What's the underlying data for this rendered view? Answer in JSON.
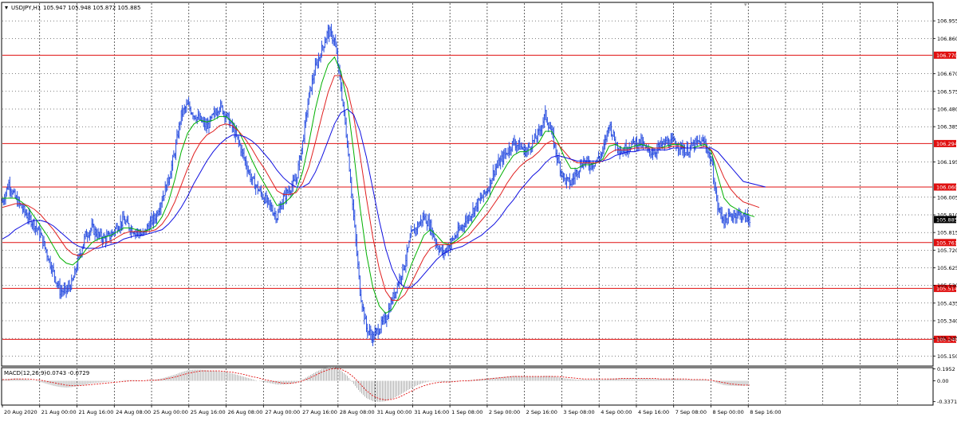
{
  "chart_data": {
    "type": "candlestick",
    "symbol_label": "USDJPY,H1",
    "ohlc_text": "105.947 105.948 105.872 105.885",
    "main_pane": {
      "ylim": [
        105.1,
        107.05
      ],
      "price_ticks": [
        "106.955",
        "106.860",
        "106.670",
        "106.575",
        "106.480",
        "106.385",
        "106.195",
        "106.005",
        "105.910",
        "105.815",
        "105.720",
        "105.625",
        "105.530",
        "105.435",
        "105.340",
        "105.245",
        "105.150"
      ],
      "horizontal_levels": [
        106.77,
        106.294,
        106.06,
        105.761,
        105.514,
        105.24
      ],
      "horizontal_level_labels": [
        "106.770",
        "106.294",
        "106.060",
        "105.761",
        "105.514",
        "105.240"
      ],
      "current_price": 105.885,
      "current_price_label": "105.885",
      "close_series": [
        105.98,
        106.08,
        106.0,
        105.95,
        105.9,
        105.86,
        105.8,
        105.7,
        105.6,
        105.5,
        105.5,
        105.55,
        105.68,
        105.8,
        105.84,
        105.8,
        105.78,
        105.8,
        105.85,
        105.88,
        105.84,
        105.82,
        105.8,
        105.86,
        105.9,
        106.0,
        106.1,
        106.25,
        106.45,
        106.5,
        106.45,
        106.42,
        106.38,
        106.44,
        106.5,
        106.45,
        106.38,
        106.3,
        106.2,
        106.1,
        106.05,
        106.0,
        105.95,
        105.9,
        106.0,
        106.05,
        106.1,
        106.3,
        106.55,
        106.7,
        106.8,
        106.9,
        106.85,
        106.6,
        106.3,
        105.9,
        105.5,
        105.3,
        105.25,
        105.3,
        105.35,
        105.45,
        105.55,
        105.65,
        105.8,
        105.85,
        105.9,
        105.85,
        105.75,
        105.7,
        105.75,
        105.8,
        105.85,
        105.9,
        105.95,
        106.0,
        106.05,
        106.15,
        106.2,
        106.25,
        106.3,
        106.28,
        106.25,
        106.3,
        106.35,
        106.45,
        106.35,
        106.2,
        106.1,
        106.08,
        106.15,
        106.2,
        106.18,
        106.2,
        106.25,
        106.4,
        106.3,
        106.25,
        106.28,
        106.3,
        106.3,
        106.25,
        106.25,
        106.28,
        106.3,
        106.3,
        106.28,
        106.25,
        106.28,
        106.3,
        106.3,
        106.2,
        105.95,
        105.88,
        105.9,
        105.92,
        105.9,
        105.885
      ],
      "overlay_lines": [
        {
          "color": "#00b000",
          "series": [
            106.0,
            106.0,
            106.0,
            105.98,
            105.95,
            105.9,
            105.85,
            105.8,
            105.74,
            105.68,
            105.65,
            105.64,
            105.67,
            105.72,
            105.76,
            105.78,
            105.79,
            105.8,
            105.82,
            105.84,
            105.84,
            105.83,
            105.82,
            105.83,
            105.85,
            105.9,
            105.98,
            106.1,
            106.25,
            106.35,
            106.4,
            106.42,
            106.41,
            106.42,
            106.44,
            106.44,
            106.41,
            106.36,
            106.29,
            106.21,
            106.14,
            106.08,
            106.02,
            105.96,
            105.97,
            106.0,
            106.04,
            106.14,
            106.3,
            106.48,
            106.62,
            106.72,
            106.76,
            106.68,
            106.52,
            106.25,
            105.95,
            105.7,
            105.52,
            105.42,
            105.38,
            105.4,
            105.46,
            105.54,
            105.64,
            105.72,
            105.8,
            105.83,
            105.8,
            105.76,
            105.75,
            105.77,
            105.8,
            105.84,
            105.89,
            105.94,
            105.99,
            106.06,
            106.12,
            106.18,
            106.23,
            106.25,
            106.25,
            106.27,
            106.3,
            106.36,
            106.36,
            106.3,
            106.22,
            106.16,
            106.16,
            106.18,
            106.18,
            106.19,
            106.21,
            106.28,
            106.29,
            106.27,
            106.27,
            106.28,
            106.29,
            106.28,
            106.27,
            106.27,
            106.28,
            106.29,
            106.29,
            106.27,
            106.27,
            106.28,
            106.29,
            106.25,
            106.12,
            106.0,
            105.96,
            105.94,
            105.92,
            105.9
          ]
        },
        {
          "color": "#e02020",
          "series": [
            105.95,
            105.96,
            105.97,
            105.97,
            105.96,
            105.94,
            105.91,
            105.87,
            105.83,
            105.78,
            105.73,
            105.7,
            105.69,
            105.7,
            105.72,
            105.74,
            105.76,
            105.77,
            105.79,
            105.81,
            105.82,
            105.82,
            105.82,
            105.82,
            105.83,
            105.86,
            105.91,
            105.98,
            106.07,
            106.16,
            106.24,
            106.3,
            106.34,
            106.36,
            106.39,
            106.4,
            106.39,
            106.36,
            106.32,
            106.27,
            106.21,
            106.16,
            106.1,
            106.04,
            106.02,
            106.02,
            106.03,
            106.08,
            106.17,
            106.3,
            106.44,
            106.57,
            106.66,
            106.66,
            106.59,
            106.44,
            106.23,
            106.0,
            105.79,
            105.62,
            105.5,
            105.45,
            105.45,
            105.48,
            105.54,
            105.61,
            105.68,
            105.73,
            105.75,
            105.75,
            105.75,
            105.76,
            105.78,
            105.8,
            105.84,
            105.88,
            105.92,
            105.97,
            106.02,
            106.08,
            106.13,
            106.17,
            106.2,
            106.22,
            106.25,
            106.29,
            106.31,
            106.29,
            106.25,
            106.21,
            106.19,
            106.19,
            106.19,
            106.19,
            106.2,
            106.24,
            106.26,
            106.26,
            106.26,
            106.27,
            106.27,
            106.27,
            106.27,
            106.27,
            106.27,
            106.28,
            106.28,
            106.27,
            106.27,
            106.27,
            106.28,
            106.26,
            106.19,
            106.11,
            106.05,
            106.01,
            105.98,
            105.95
          ]
        },
        {
          "color": "#1010e0",
          "series": [
            105.78,
            105.8,
            105.83,
            105.85,
            105.87,
            105.88,
            105.88,
            105.87,
            105.85,
            105.82,
            105.79,
            105.76,
            105.74,
            105.73,
            105.73,
            105.73,
            105.74,
            105.75,
            105.76,
            105.78,
            105.79,
            105.8,
            105.8,
            105.81,
            105.82,
            105.83,
            105.86,
            105.9,
            105.95,
            106.01,
            106.08,
            106.14,
            106.2,
            106.25,
            106.29,
            106.32,
            106.34,
            106.34,
            106.33,
            106.31,
            106.28,
            106.24,
            106.2,
            106.15,
            106.11,
            106.08,
            106.06,
            106.06,
            106.08,
            106.14,
            106.22,
            106.31,
            106.4,
            106.46,
            106.48,
            106.45,
            106.36,
            106.22,
            106.05,
            105.88,
            105.73,
            105.62,
            105.55,
            105.52,
            105.52,
            105.55,
            105.59,
            105.63,
            105.67,
            105.7,
            105.72,
            105.73,
            105.74,
            105.76,
            105.78,
            105.8,
            105.83,
            105.86,
            105.9,
            105.95,
            105.99,
            106.04,
            106.08,
            106.12,
            106.15,
            106.19,
            106.22,
            106.23,
            106.22,
            106.21,
            106.2,
            106.2,
            106.2,
            106.2,
            106.2,
            106.21,
            106.23,
            106.24,
            106.25,
            106.25,
            106.26,
            106.26,
            106.26,
            106.26,
            106.26,
            106.27,
            106.27,
            106.27,
            106.27,
            106.27,
            106.27,
            106.27,
            106.25,
            106.21,
            106.17,
            106.13,
            106.09,
            106.06
          ]
        }
      ]
    },
    "macd_pane": {
      "title": "MACD(12,26,9)",
      "values_text": "-0.0743 -0.0729",
      "ylim": [
        -0.38,
        0.2
      ],
      "ticks": [
        "0.1952",
        "0.00",
        "-0.3371"
      ],
      "histogram": [
        0.02,
        0.03,
        0.04,
        0.03,
        0.02,
        0.0,
        -0.02,
        -0.05,
        -0.08,
        -0.1,
        -0.11,
        -0.1,
        -0.08,
        -0.06,
        -0.04,
        -0.03,
        -0.02,
        -0.01,
        0.0,
        0.01,
        0.01,
        0.01,
        0.0,
        0.01,
        0.02,
        0.04,
        0.07,
        0.1,
        0.14,
        0.17,
        0.18,
        0.18,
        0.17,
        0.16,
        0.15,
        0.14,
        0.12,
        0.09,
        0.06,
        0.03,
        0.0,
        -0.02,
        -0.04,
        -0.06,
        -0.06,
        -0.05,
        -0.03,
        0.02,
        0.08,
        0.14,
        0.19,
        0.22,
        0.22,
        0.17,
        0.08,
        -0.05,
        -0.18,
        -0.28,
        -0.33,
        -0.34,
        -0.33,
        -0.29,
        -0.24,
        -0.18,
        -0.12,
        -0.07,
        -0.03,
        -0.01,
        -0.01,
        -0.02,
        -0.02,
        -0.01,
        0.0,
        0.01,
        0.02,
        0.03,
        0.04,
        0.05,
        0.06,
        0.07,
        0.08,
        0.08,
        0.07,
        0.07,
        0.07,
        0.08,
        0.08,
        0.06,
        0.04,
        0.03,
        0.02,
        0.02,
        0.02,
        0.02,
        0.02,
        0.03,
        0.04,
        0.04,
        0.04,
        0.04,
        0.04,
        0.04,
        0.03,
        0.03,
        0.03,
        0.03,
        0.03,
        0.02,
        0.02,
        0.02,
        0.02,
        0.0,
        -0.04,
        -0.07,
        -0.08,
        -0.08,
        -0.08,
        -0.07
      ],
      "signal": [
        0.02,
        0.02,
        0.03,
        0.03,
        0.03,
        0.02,
        0.01,
        -0.01,
        -0.03,
        -0.05,
        -0.07,
        -0.08,
        -0.08,
        -0.07,
        -0.06,
        -0.05,
        -0.04,
        -0.03,
        -0.02,
        -0.01,
        0.0,
        0.0,
        0.0,
        0.01,
        0.01,
        0.02,
        0.04,
        0.06,
        0.09,
        0.12,
        0.14,
        0.16,
        0.16,
        0.16,
        0.16,
        0.15,
        0.14,
        0.12,
        0.1,
        0.07,
        0.05,
        0.02,
        0.0,
        -0.02,
        -0.04,
        -0.04,
        -0.03,
        0.0,
        0.04,
        0.09,
        0.14,
        0.18,
        0.2,
        0.19,
        0.14,
        0.06,
        -0.05,
        -0.16,
        -0.24,
        -0.29,
        -0.31,
        -0.3,
        -0.27,
        -0.22,
        -0.17,
        -0.12,
        -0.08,
        -0.05,
        -0.03,
        -0.02,
        -0.02,
        -0.01,
        0.0,
        0.0,
        0.01,
        0.02,
        0.03,
        0.04,
        0.05,
        0.06,
        0.07,
        0.07,
        0.07,
        0.07,
        0.07,
        0.07,
        0.07,
        0.07,
        0.06,
        0.05,
        0.04,
        0.03,
        0.03,
        0.03,
        0.03,
        0.03,
        0.03,
        0.04,
        0.04,
        0.04,
        0.04,
        0.04,
        0.04,
        0.03,
        0.03,
        0.03,
        0.03,
        0.03,
        0.02,
        0.02,
        0.02,
        0.01,
        -0.01,
        -0.03,
        -0.05,
        -0.06,
        -0.07,
        -0.07
      ]
    },
    "time_labels": [
      "20 Aug 2020",
      "21 Aug 00:00",
      "21 Aug 16:00",
      "24 Aug 08:00",
      "25 Aug 00:00",
      "25 Aug 16:00",
      "26 Aug 08:00",
      "27 Aug 00:00",
      "27 Aug 16:00",
      "28 Aug 08:00",
      "31 Aug 00:00",
      "31 Aug 16:00",
      "1 Sep 08:00",
      "2 Sep 00:00",
      "2 Sep 16:00",
      "3 Sep 08:00",
      "4 Sep 00:00",
      "4 Sep 16:00",
      "7 Sep 08:00",
      "8 Sep 00:00",
      "8 Sep 16:00"
    ]
  }
}
